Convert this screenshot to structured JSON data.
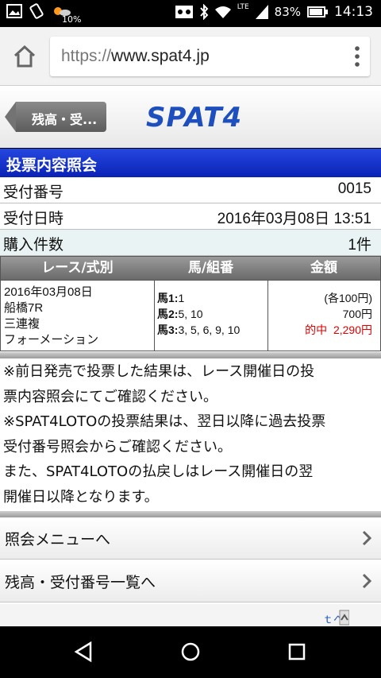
{
  "status_bar": {
    "battery_percent_small": "10%",
    "signal_label": "LTE",
    "battery_percent": "83%",
    "time": "14:13",
    "icons": [
      "image-icon",
      "rotation-icon",
      "weather-icon",
      "voicemail-icon",
      "bluetooth-icon",
      "wifi-icon",
      "signal-icon",
      "battery-icon"
    ]
  },
  "browser": {
    "url_scheme": "https://",
    "url_host": "www.spat4.jp",
    "icons": [
      "home-icon",
      "overflow-menu-icon"
    ]
  },
  "header": {
    "back_label": "残高・受...",
    "logo": "SPAT4"
  },
  "page": {
    "title": "投票内容照会"
  },
  "info": {
    "receipt_no_label": "受付番号",
    "receipt_no": "0015",
    "receipt_date_label": "受付日時",
    "receipt_date": "2016年03月08日 13:51",
    "count_label": "購入件数",
    "count": "1件"
  },
  "bet_table": {
    "headers": [
      "レース/式別",
      "馬/組番",
      "金額"
    ],
    "race": {
      "date": "2016年03月08日",
      "venue": "船橋7R",
      "bet_type": "三連複",
      "method": "フォーメーション"
    },
    "combos": [
      {
        "label": "馬1:",
        "value": "1"
      },
      {
        "label": "馬2:",
        "value": "5, 10"
      },
      {
        "label": "馬3:",
        "value": "3, 5, 6, 9, 10"
      }
    ],
    "amount": {
      "unit": "(各100円)",
      "total": "700円",
      "hit_label": "的中",
      "payout": "2,290円"
    },
    "colors": {
      "hit": "#e00000",
      "header_bg": "#7a7a7a"
    }
  },
  "notes": [
    "※前日発売で投票した結果は、レース開催日の投",
    "票内容照会にてご確認ください。",
    "※SPAT4LOTOの投票結果は、翌日以降に過去投票",
    "受付番号照会からご確認ください。",
    "また、SPAT4LOTOの払戻しはレース開催日の翌",
    "開催日以降となります。"
  ],
  "menu": {
    "inquiry_menu": "照会メニューへ",
    "balance_list": "残高・受付番号一覧へ"
  },
  "colors": {
    "title_bar": "#1535c8",
    "logo": "#1d4fbf"
  },
  "nav_icons": [
    "back-icon",
    "home-circle-icon",
    "recents-icon"
  ]
}
